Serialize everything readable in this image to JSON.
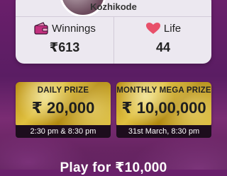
{
  "profile": {
    "city": "Kozhikode"
  },
  "stats": {
    "winnings_label": "Winnings",
    "winnings_value": "₹613",
    "life_label": "Life",
    "life_value": "44"
  },
  "prizes": {
    "daily": {
      "title": "DAILY PRIZE",
      "amount": "₹ 20,000",
      "time": "2:30 pm & 8:30 pm"
    },
    "monthly": {
      "title": "MONTHLY MEGA PRIZE",
      "amount": "₹ 10,00,000",
      "time": "31st March, 8:30 pm"
    }
  },
  "cta": {
    "label": "Play for ₹10,000"
  },
  "colors": {
    "background": "#5a1d63",
    "card": "#ece8f0",
    "gold": "#d8b830",
    "time_bar": "#1d0d1d",
    "heart": "#e8506a",
    "wallet": "#c2307e"
  }
}
